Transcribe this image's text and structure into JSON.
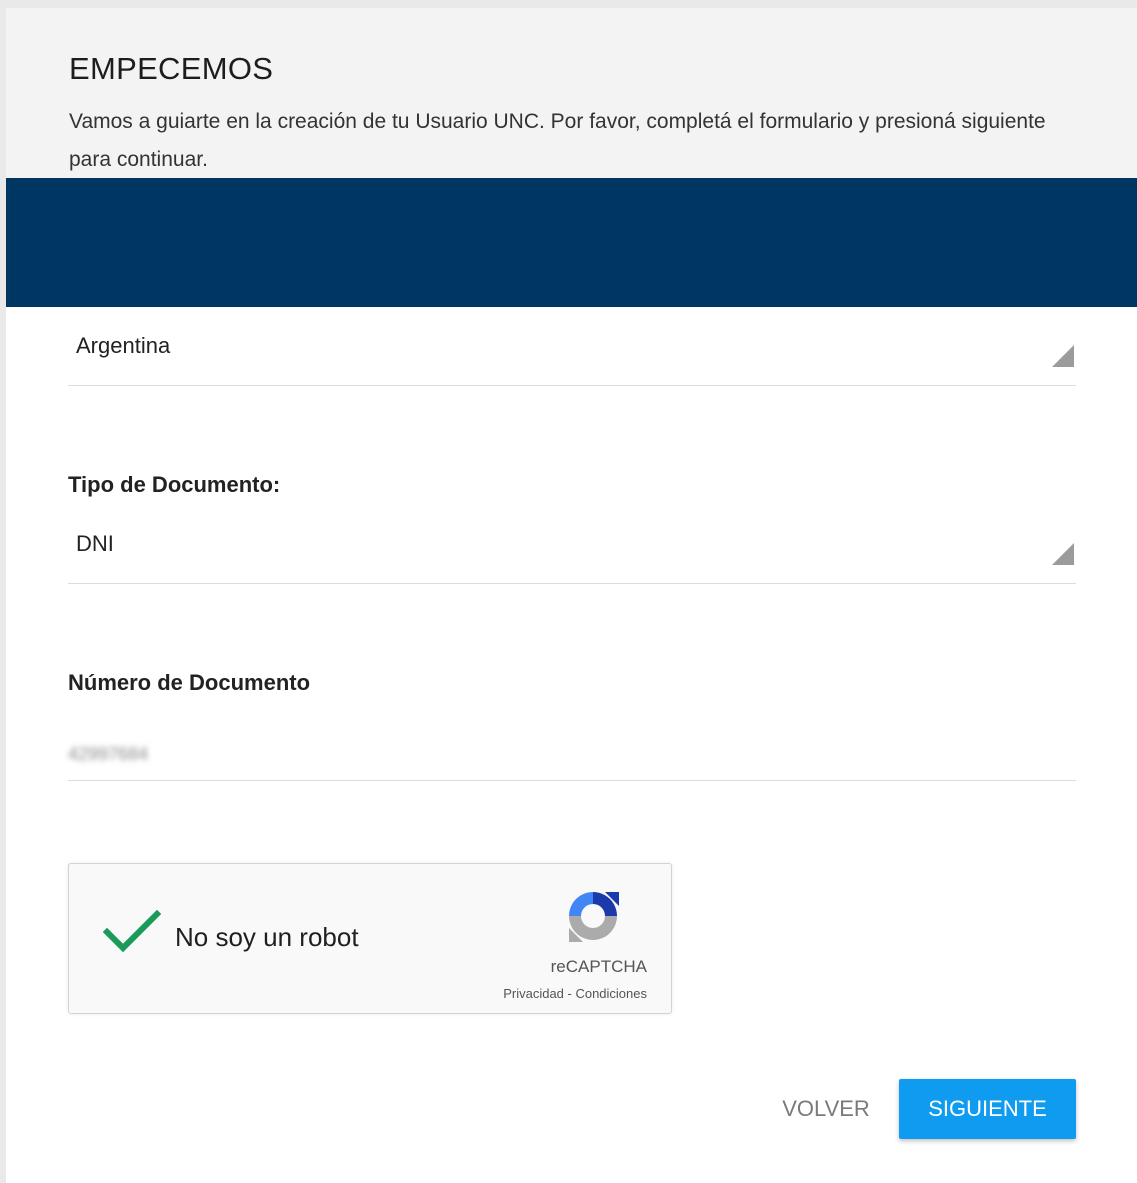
{
  "header": {
    "title": "EMPECEMOS",
    "intro": "Vamos a guiarte en la creación de tu Usuario UNC. Por favor, completá el formulario y presioná siguiente para continuar."
  },
  "colors": {
    "banner": "#003662",
    "primary_button": "#0f9bef",
    "check": "#1a9b59"
  },
  "form": {
    "country": {
      "value": "Argentina"
    },
    "doc_type": {
      "label": "Tipo de Documento:",
      "value": "DNI"
    },
    "doc_number": {
      "label": "Número de Documento",
      "value": "42997684"
    }
  },
  "captcha": {
    "text": "No soy un robot",
    "brand": "reCAPTCHA",
    "links": "Privacidad - Condiciones",
    "checked": true
  },
  "actions": {
    "back_label": "VOLVER",
    "next_label": "SIGUIENTE"
  }
}
